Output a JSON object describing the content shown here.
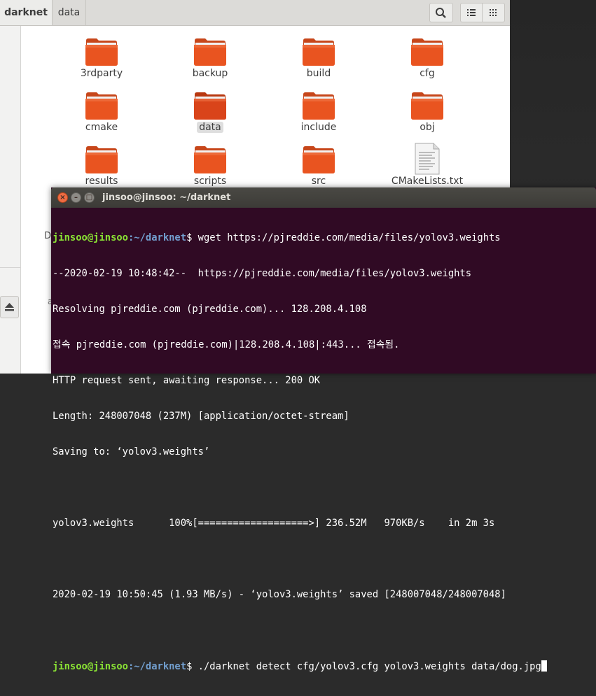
{
  "files": {
    "breadcrumb": [
      "darknet",
      "data"
    ],
    "items": [
      {
        "label": "3rdparty",
        "icon": "folder-icon",
        "selected": false
      },
      {
        "label": "backup",
        "icon": "folder-icon",
        "selected": false
      },
      {
        "label": "build",
        "icon": "folder-icon",
        "selected": false
      },
      {
        "label": "cfg",
        "icon": "folder-icon",
        "selected": false
      },
      {
        "label": "cmake",
        "icon": "folder-icon",
        "selected": false
      },
      {
        "label": "data",
        "icon": "folder-icon",
        "selected": true
      },
      {
        "label": "include",
        "icon": "folder-icon",
        "selected": false
      },
      {
        "label": "obj",
        "icon": "folder-icon",
        "selected": false
      },
      {
        "label": "results",
        "icon": "folder-icon",
        "selected": false
      },
      {
        "label": "scripts",
        "icon": "folder-icon",
        "selected": false
      },
      {
        "label": "src",
        "icon": "folder-icon",
        "selected": false
      },
      {
        "label": "CMakeLists.txt",
        "icon": "text-file-icon",
        "selected": false
      }
    ],
    "partial_label_d": "D",
    "partial_label_a": "a"
  },
  "terminal": {
    "title": "jinsoo@jinsoo: ~/darknet",
    "prompt_user": "jinsoo@jinsoo",
    "prompt_path": ":~/darknet",
    "prompt_symbol": "$",
    "command1": " wget https://pjreddie.com/media/files/yolov3.weights",
    "output": [
      "--2020-02-19 10:48:42--  https://pjreddie.com/media/files/yolov3.weights",
      "Resolving pjreddie.com (pjreddie.com)... 128.208.4.108",
      "접속 pjreddie.com (pjreddie.com)|128.208.4.108|:443... 접속됨.",
      "HTTP request sent, awaiting response... 200 OK",
      "Length: 248007048 (237M) [application/octet-stream]",
      "Saving to: ‘yolov3.weights’",
      "",
      "yolov3.weights      100%[===================>] 236.52M   970KB/s    in 2m 3s",
      "",
      "2020-02-19 10:50:45 (1.93 MB/s) - ‘yolov3.weights’ saved [248007048/248007048]",
      ""
    ],
    "command2": " ./darknet detect cfg/yolov3.cfg yolov3.weights data/dog.jpg"
  },
  "colors": {
    "folder": "#e95420",
    "terminal_bg": "#300a24",
    "prompt_user": "#8ae234",
    "prompt_path": "#729fcf"
  }
}
